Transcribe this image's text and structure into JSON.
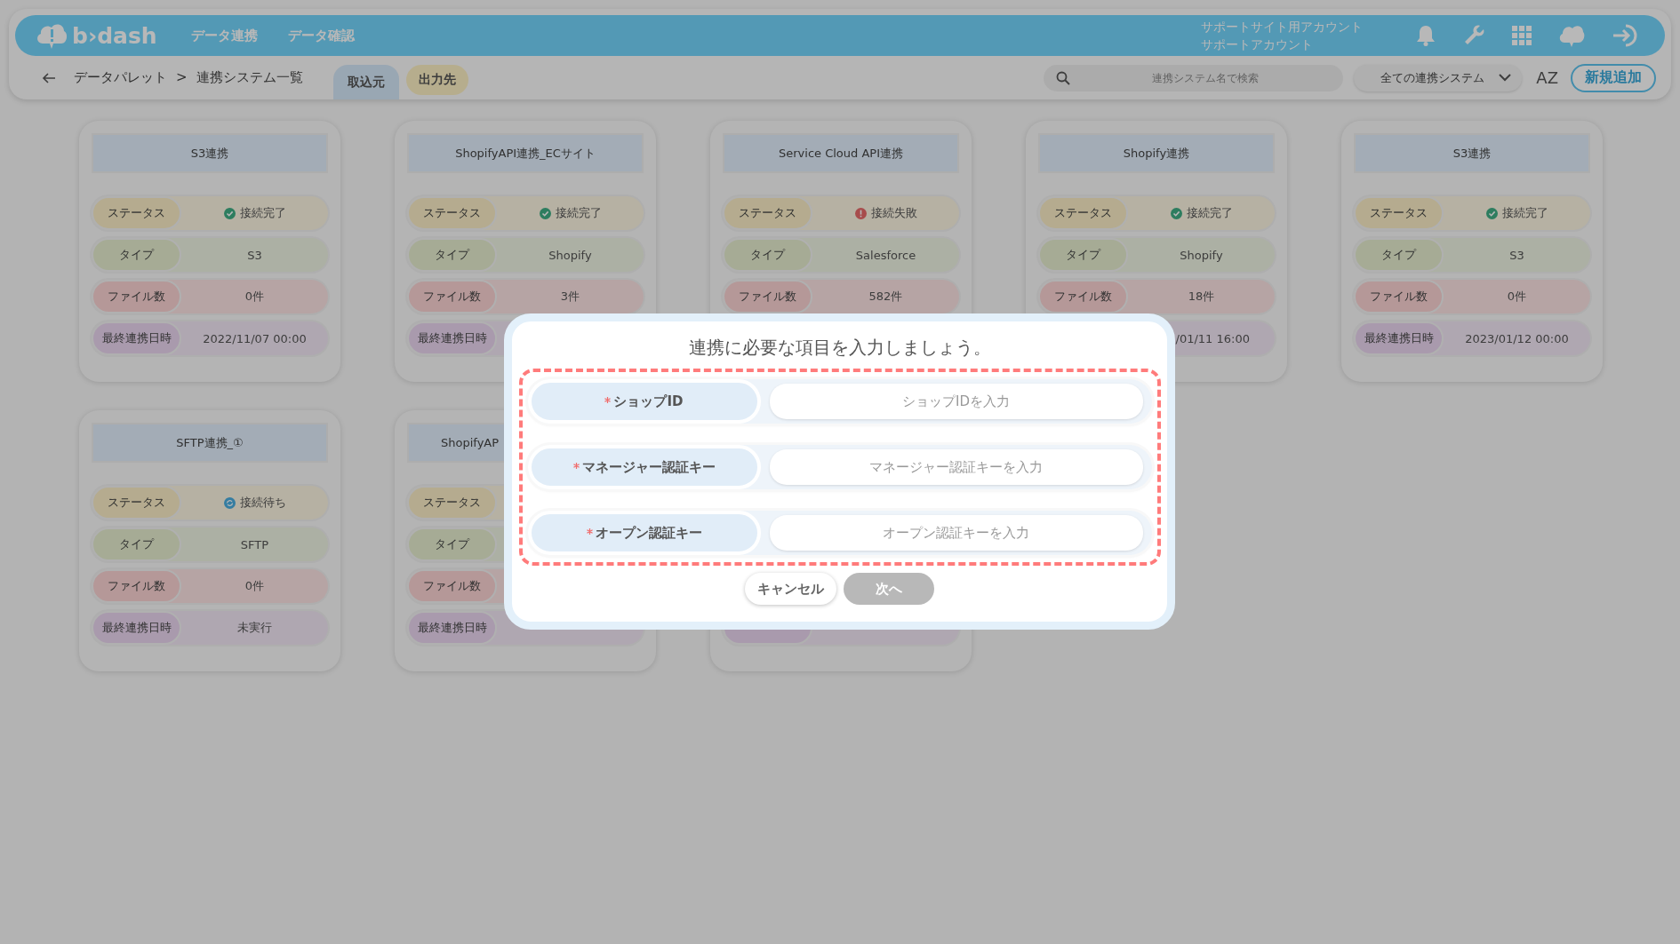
{
  "header": {
    "logo": "b›dash",
    "nav": [
      {
        "label": "データ連携"
      },
      {
        "label": "データ確認"
      }
    ],
    "account": {
      "line1": "サポートサイト用アカウント",
      "line2": "サポートアカウント"
    }
  },
  "toolbar": {
    "breadcrumb": [
      "データパレット",
      ">",
      "連携システム一覧"
    ],
    "tabs": [
      {
        "label": "取込元",
        "selected": true
      },
      {
        "label": "出力先",
        "selected": false
      }
    ],
    "search": {
      "placeholder": "連携システム名で検索"
    },
    "filter": {
      "value": "全ての連携システム"
    },
    "sort_label": "AZ",
    "add_button": "新規追加"
  },
  "cards": [
    {
      "kind": "card",
      "title": "S3連携",
      "rows": [
        {
          "kind": "status",
          "label": "ステータス",
          "value": "接続完了",
          "icon": {
            "kind": "ok"
          }
        },
        {
          "kind": "type",
          "label": "タイプ",
          "value": "S3"
        },
        {
          "kind": "files",
          "label": "ファイル数",
          "value": "0件"
        },
        {
          "kind": "date",
          "label": "最終連携日時",
          "value": "2022/11/07 00:00"
        }
      ]
    },
    {
      "kind": "card",
      "title": "ShopifyAPI連携_ECサイト",
      "rows": [
        {
          "kind": "status",
          "label": "ステータス",
          "value": "接続完了",
          "icon": {
            "kind": "ok"
          }
        },
        {
          "kind": "type",
          "label": "タイプ",
          "value": "Shopify"
        },
        {
          "kind": "files",
          "label": "ファイル数",
          "value": "3件"
        },
        {
          "kind": "date",
          "label": "最終連携日時"
        }
      ]
    },
    {
      "kind": "card",
      "title": "Service Cloud API連携",
      "rows": [
        {
          "kind": "status",
          "label": "ステータス",
          "value": "接続失敗",
          "icon": {
            "kind": "error"
          }
        },
        {
          "kind": "type",
          "label": "タイプ",
          "value": "Salesforce"
        },
        {
          "kind": "files",
          "label": "ファイル数",
          "value": "582件"
        }
      ]
    },
    {
      "kind": "card",
      "title": "Shopify連携",
      "rows": [
        {
          "kind": "status",
          "label": "ステータス",
          "value": "接続完了",
          "icon": {
            "kind": "ok"
          }
        },
        {
          "kind": "type",
          "label": "タイプ",
          "value": "Shopify"
        },
        {
          "kind": "files",
          "label": "ファイル数",
          "value": "18件"
        },
        {
          "kind": "date",
          "value": "/01/11 16:00",
          "clipped": true
        }
      ]
    },
    {
      "kind": "card",
      "title": "S3連携",
      "rows": [
        {
          "kind": "status",
          "label": "ステータス",
          "value": "接続完了",
          "icon": {
            "kind": "ok"
          }
        },
        {
          "kind": "type",
          "label": "タイプ",
          "value": "S3"
        },
        {
          "kind": "files",
          "label": "ファイル数",
          "value": "0件"
        },
        {
          "kind": "date",
          "label": "最終連携日時",
          "value": "2023/01/12 00:00"
        }
      ]
    },
    {
      "kind": "card",
      "title": "SFTP連携_①",
      "rows": [
        {
          "kind": "status",
          "label": "ステータス",
          "value": "接続待ち",
          "icon": {
            "kind": "waiting"
          }
        },
        {
          "kind": "type",
          "label": "タイプ",
          "value": "SFTP"
        },
        {
          "kind": "files",
          "label": "ファイル数",
          "value": "0件"
        },
        {
          "kind": "date",
          "label": "最終連携日時",
          "value": "未実行"
        }
      ]
    },
    {
      "kind": "card",
      "title": "ShopifyAP",
      "clipped": true,
      "rows": [
        {
          "kind": "status",
          "label": "ステータス"
        },
        {
          "kind": "type",
          "label": "タイプ"
        },
        {
          "kind": "files",
          "label": "ファイル数"
        },
        {
          "kind": "date",
          "label": "最終連携日時"
        }
      ]
    },
    {
      "kind": "covered"
    }
  ],
  "modal": {
    "title": "連携に必要な項目を入力しましょう。",
    "fields": [
      {
        "label": "ショップID",
        "required": true,
        "placeholder": "ショップIDを入力"
      },
      {
        "label": "マネージャー認証キー",
        "required": true,
        "placeholder": "マネージャー認証キーを入力"
      },
      {
        "label": "オープン認証キー",
        "required": true,
        "placeholder": "オープン認証キーを入力"
      }
    ],
    "buttons": [
      {
        "label": "キャンセル",
        "kind": "secondary",
        "disabled": false
      },
      {
        "label": "次へ",
        "kind": "primary",
        "disabled": true
      }
    ]
  }
}
